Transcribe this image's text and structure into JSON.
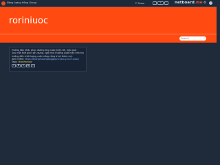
{
  "topbar": {
    "brand_name": "Năng lượng Hồng Group",
    "share_label": "Share",
    "share_icon": "share-icon",
    "nav_icons": [
      "bell-icon",
      "plus-icon",
      "chat-icon"
    ],
    "logo_text": "netboard",
    "logo_suffix": ".me",
    "settings_icon": "gear-icon",
    "colors": {
      "bar": "#1c2a3c",
      "logo_accent": "#f05a28"
    }
  },
  "header": {
    "title": "roriniuoc",
    "colors": {
      "background": "#ff4a11"
    }
  },
  "search": {
    "placeholder": "Search",
    "icon": "search-icon"
  },
  "post": {
    "line1": "Hướng dẫn khắc phục đường ống nước triển để, hiệu quả",
    "line2": "Sau một thời gian xây dựng, ngôi nhà thường xuất hiện tình trạng rò rỉ nước, ảnh",
    "line3": "hưởng đến chất lượng cuộc sống công trình thẩm mỹ.",
    "link_prefix": "Xem thêm: ",
    "link_text": "https://thongnuocnganggiay.vn/xu-ly-ro-ri-nuoc/",
    "tags_prefix": "Tags: ",
    "tag": "#ronhanuoc",
    "actions": [
      "link-icon",
      "heart-icon",
      "comment-icon",
      "bookmark-icon",
      "share-icon"
    ]
  },
  "page": {
    "colors": {
      "background": "#1f2a3a",
      "card": "#182435"
    }
  }
}
